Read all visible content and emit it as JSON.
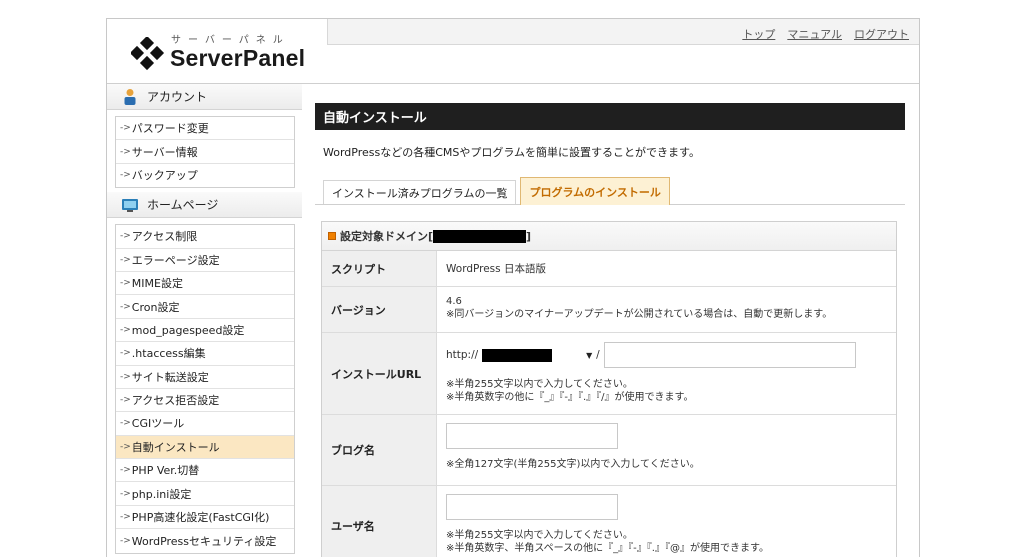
{
  "header": {
    "logo_kana": "サーバーパネル",
    "logo_text": "ServerPanel",
    "links": [
      "トップ",
      "マニュアル",
      "ログアウト"
    ]
  },
  "sidebar": {
    "sections": [
      {
        "title": "アカウント",
        "icon": "user-icon",
        "items": [
          "パスワード変更",
          "サーバー情報",
          "バックアップ"
        ]
      },
      {
        "title": "ホームページ",
        "icon": "monitor-icon",
        "items": [
          "アクセス制限",
          "エラーページ設定",
          "MIME設定",
          "Cron設定",
          "mod_pagespeed設定",
          ".htaccess編集",
          "サイト転送設定",
          "アクセス拒否設定",
          "CGIツール",
          "自動インストール",
          "PHP Ver.切替",
          "php.ini設定",
          "PHP高速化設定(FastCGI化)",
          "WordPressセキュリティ設定"
        ]
      }
    ],
    "active_item": "自動インストール"
  },
  "main": {
    "title": "自動インストール",
    "description": "WordPressなどの各種CMSやプログラムを簡単に設置することができます。",
    "tabs": [
      {
        "label": "インストール済みプログラムの一覧",
        "active": false
      },
      {
        "label": "プログラムのインストール",
        "active": true
      }
    ],
    "panel": {
      "heading_prefix": "設定対象ドメイン[",
      "heading_suffix": "]",
      "rows": {
        "script": {
          "label": "スクリプト",
          "value": "WordPress 日本語版"
        },
        "version": {
          "label": "バージョン",
          "value": "4.6",
          "note": "※同バージョンのマイナーアップデートが公開されている場合は、自動で更新します。"
        },
        "install_url": {
          "label": "インストールURL",
          "prefix": "http://",
          "slash": "/",
          "value": "",
          "notes": [
            "※半角255文字以内で入力してください。",
            "※半角英数字の他に『_』『-』『.』『/』が使用できます。"
          ]
        },
        "blog_name": {
          "label": "ブログ名",
          "value": "",
          "note": "※全角127文字(半角255文字)以内で入力してください。"
        },
        "user_name": {
          "label": "ユーザ名",
          "value": "",
          "notes": [
            "※半角255文字以内で入力してください。",
            "※半角英数字、半角スペースの他に『_』『-』『.』『@』が使用できます。"
          ]
        }
      }
    }
  },
  "colors": {
    "accent": "#f08000",
    "active_tab_text": "#c26b00",
    "active_bg": "#fbe7c2",
    "title_bar": "#1f1f1f"
  }
}
